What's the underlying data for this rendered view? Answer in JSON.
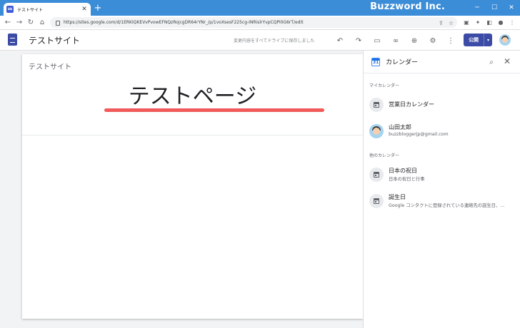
{
  "window": {
    "brand": "Buzzword Inc.",
    "controls": {
      "minimize": "─",
      "maximize": "☐",
      "close": "✕"
    }
  },
  "browser": {
    "tab_title": "テストサイト",
    "tab_close": "✕",
    "new_tab": "+",
    "url": "https://sites.google.com/d/1ERKIQKEVvPvowEFNQzRojcgDR64rYNr_/p/1voXsesF225cg-INRislrYvpCQPi0G6rT/edit",
    "nav": {
      "back": "←",
      "forward": "→",
      "reload": "↻",
      "home": "⌂"
    }
  },
  "app_header": {
    "site_name": "テストサイト",
    "saved_message": "変更内容をすべてドライブに保存しました",
    "publish_label": "公開",
    "publish_dropdown": "▾",
    "icons": {
      "undo": "↶",
      "redo": "↷",
      "preview": "▭",
      "link": "∞",
      "share": "⊕",
      "settings": "⚙",
      "more": "⋮"
    }
  },
  "page": {
    "site_name": "テストサイト",
    "title": "テストページ"
  },
  "calendar_panel": {
    "title": "カレンダー",
    "search_glyph": "⌕",
    "close_glyph": "✕",
    "my_calendars_label": "マイカレンダー",
    "other_calendars_label": "他のカレンダー",
    "my_calendars": [
      {
        "name": "営業日カレンダー",
        "sub": ""
      },
      {
        "name": "山田太郎",
        "sub": "buzzbloggerjp@gmail.com"
      }
    ],
    "other_calendars": [
      {
        "name": "日本の祝日",
        "sub": "日本の祝日と行事"
      },
      {
        "name": "誕生日",
        "sub": "Google コンタクトに登録されている連絡先の誕生日、…"
      }
    ]
  }
}
